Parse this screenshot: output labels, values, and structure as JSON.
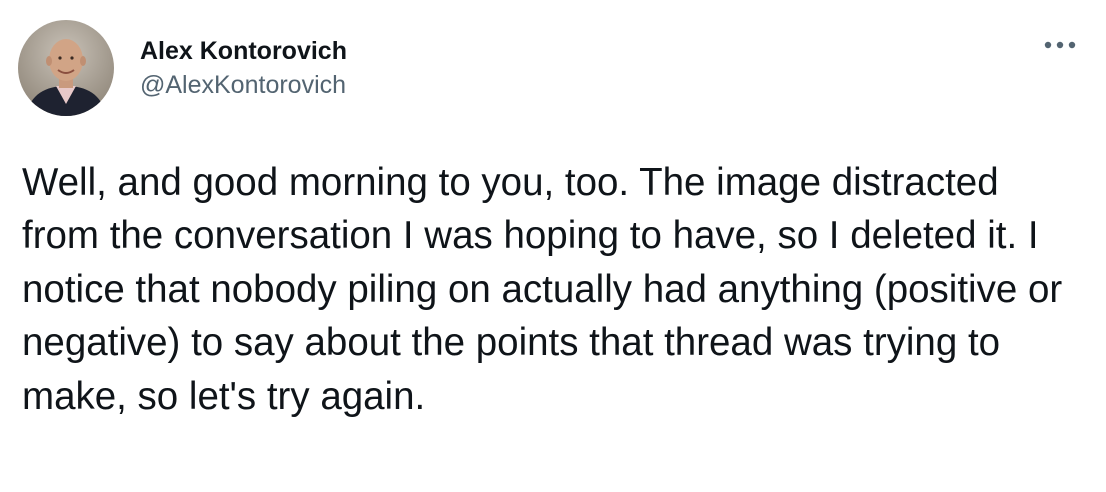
{
  "author": {
    "display_name": "Alex Kontorovich",
    "handle": "@AlexKontorovich",
    "avatar_icon": "profile-photo"
  },
  "tweet": {
    "text": "Well, and good morning to you, too. The image distracted from the conversation I was hoping to have, so I deleted it. I notice that nobody piling on actually had anything (positive or negative) to say about the points that thread was trying to make, so let's try again."
  },
  "menu": {
    "icon": "more-horizontal-icon"
  },
  "colors": {
    "text_primary": "#0f1419",
    "text_secondary": "#536471",
    "background": "#ffffff"
  }
}
